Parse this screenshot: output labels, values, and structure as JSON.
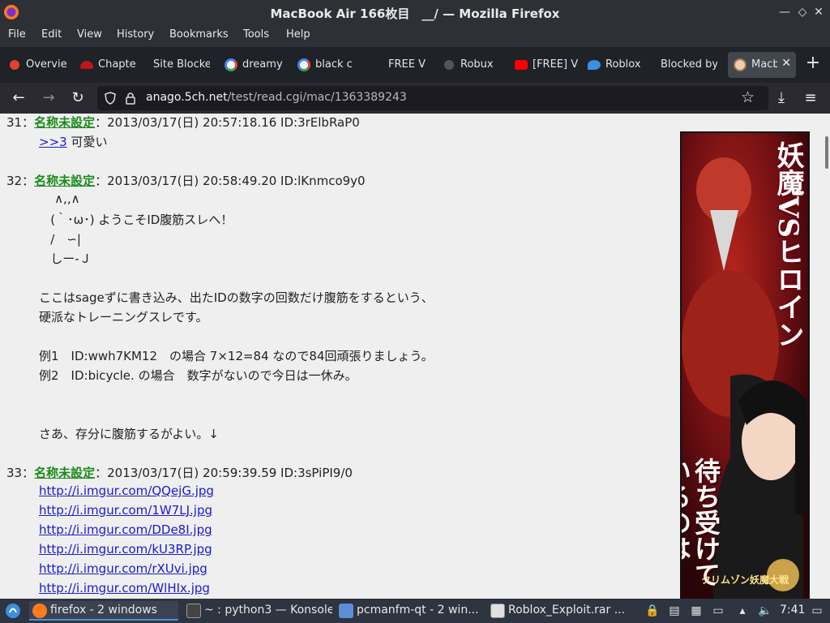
{
  "window": {
    "title": "MacBook Air 166枚目　__/ — Mozilla Firefox",
    "minimize_glyph": "—",
    "restore_glyph": "◇",
    "close_glyph": "✕"
  },
  "menu": [
    "File",
    "Edit",
    "View",
    "History",
    "Bookmarks",
    "Tools",
    "Help"
  ],
  "tabs": [
    {
      "label": "Overvie",
      "icon": "target-icon",
      "color": "#e0452b"
    },
    {
      "label": "Chapte",
      "icon": "red-hat-icon",
      "color": "#c0151c"
    },
    {
      "label": "Site Blocke",
      "icon": "none",
      "color": ""
    },
    {
      "label": "dreamy",
      "icon": "google-icon",
      "color": "#4285f4"
    },
    {
      "label": "black c",
      "icon": "google-icon",
      "color": "#4285f4"
    },
    {
      "label": "FREE V",
      "icon": "none",
      "color": ""
    },
    {
      "label": "Robux",
      "icon": "gear-icon",
      "color": "#666"
    },
    {
      "label": "[FREE] V",
      "icon": "youtube-icon",
      "color": "#ff0000"
    },
    {
      "label": "Roblox",
      "icon": "bird-icon",
      "color": "#3b8fe0"
    },
    {
      "label": "Blocked by",
      "icon": "none",
      "color": ""
    },
    {
      "label": "Macb",
      "icon": "5ch-icon",
      "color": "#c8a070",
      "active": true
    }
  ],
  "nav": {
    "url_host": "anago.5ch.net",
    "url_path": "/test/read.cgi/mac/1363389243"
  },
  "posts": [
    {
      "num": "31",
      "sep": "：",
      "name": "名称未設定",
      "meta": "：2013/03/17(日) 20:57:18.16 ID:3rElbRaP0"
    },
    {
      "num": "32",
      "sep": "：",
      "name": "名称未設定",
      "meta": "：2013/03/17(日) 20:58:49.20 ID:lKnmco9y0"
    },
    {
      "num": "33",
      "sep": "：",
      "name": "名称未設定",
      "meta": "：2013/03/17(日) 20:59:39.59 ID:3sPiPI9/0"
    }
  ],
  "post31_body": {
    "anchor": ">>3",
    "text": " 可愛い"
  },
  "post32_body": [
    "    ∧,,∧",
    "   (｀･ω･) ようこそID腹筋スレへ！",
    "   /　∽|",
    "   しー-Ｊ",
    "",
    "ここはsageずに書き込み、出たIDの数字の回数だけ腹筋をするという、",
    "硬派なトレーニングスレです。",
    "",
    "例1　ID:wwh7KM12　の場合 7×12=84 なので84回頑張りましょう。",
    "例2　ID:bicycle. の場合　数字がないので今日は一休み。",
    "",
    "",
    "さあ、存分に腹筋するがよい。↓"
  ],
  "post33_links": [
    "http://i.imgur.com/QQejG.jpg",
    "http://i.imgur.com/1W7LJ.jpg",
    "http://i.imgur.com/DDe8I.jpg",
    "http://i.imgur.com/kU3RP.jpg",
    "http://i.imgur.com/rXUvi.jpg",
    "http://i.imgur.com/WlHIx.jpg"
  ],
  "ad": {
    "headline": "妖魔VSヒロイン",
    "sub": "待ち受けているのは…",
    "logo": "クリムゾン妖魔大戦"
  },
  "taskbar": {
    "tasks": [
      {
        "label": "firefox - 2 windows",
        "icon": "firefox-icon",
        "active": true
      },
      {
        "label": "~ : python3 — Konsole",
        "icon": "terminal-icon"
      },
      {
        "label": "pcmanfm-qt - 2 win...",
        "icon": "folder-icon"
      },
      {
        "label": "Roblox_Exploit.rar ...",
        "icon": "archive-icon"
      }
    ],
    "clock": "7:41"
  }
}
